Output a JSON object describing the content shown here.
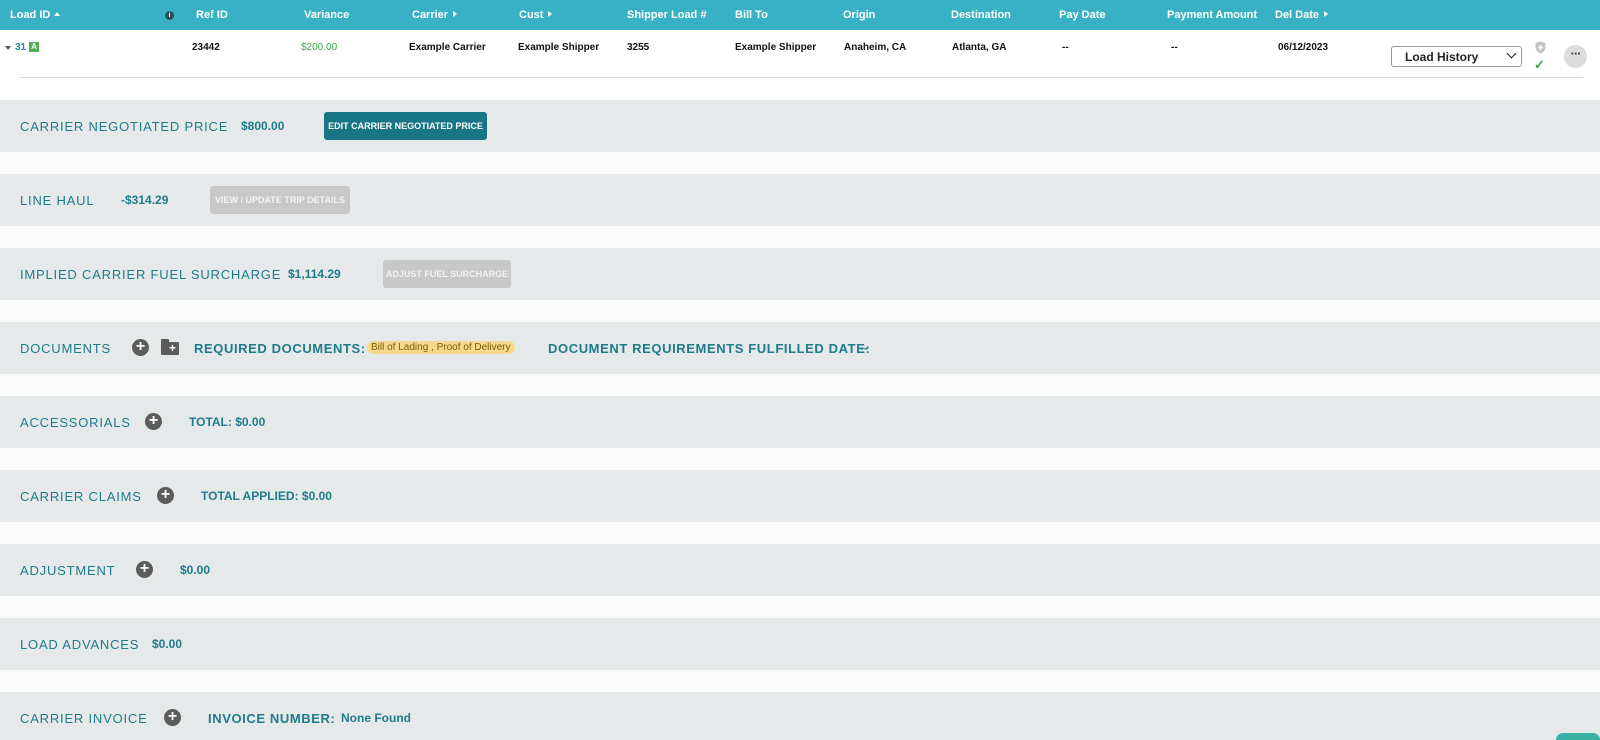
{
  "header": {
    "load_id": "Load ID",
    "ref_id": "Ref ID",
    "variance": "Variance",
    "carrier": "Carrier",
    "cust": "Cust",
    "shipper_load": "Shipper Load #",
    "bill_to": "Bill To",
    "origin": "Origin",
    "destination": "Destination",
    "pay_date": "Pay Date",
    "payment_amount": "Payment Amount",
    "del_date": "Del Date"
  },
  "row": {
    "load_id": "31",
    "badge": "A",
    "ref_id": "23442",
    "variance": "$200.00",
    "carrier": "Example Carrier",
    "cust": "Example Shipper",
    "shipper_load": "3255",
    "bill_to": "Example Shipper",
    "origin": "Anaheim, CA",
    "destination": "Atlanta, GA",
    "pay_date": "--",
    "payment_amount": "--",
    "del_date": "06/12/2023",
    "select_value": "Load History",
    "more": "···"
  },
  "sections": {
    "carrier_price": {
      "label": "CARRIER NEGOTIATED PRICE",
      "value": "$800.00",
      "button": "EDIT CARRIER NEGOTIATED PRICE"
    },
    "line_haul": {
      "label": "LINE HAUL",
      "value": "-$314.29",
      "button": "VIEW / UPDATE TRIP DETAILS"
    },
    "fuel": {
      "label": "IMPLIED CARRIER FUEL SURCHARGE",
      "value": "$1,114.29",
      "button": "ADJUST FUEL SURCHARGE"
    },
    "documents": {
      "label": "DOCUMENTS",
      "required_label": "REQUIRED DOCUMENTS:",
      "required_docs": "Bill of Lading , Proof of Delivery",
      "fulfilled_label": "DOCUMENT REQUIREMENTS FULFILLED DATE:",
      "fulfilled_value": "--"
    },
    "accessorials": {
      "label": "ACCESSORIALS",
      "total": "TOTAL: $0.00"
    },
    "claims": {
      "label": "CARRIER CLAIMS",
      "total": "TOTAL APPLIED: $0.00"
    },
    "adjustment": {
      "label": "ADJUSTMENT",
      "value": "$0.00"
    },
    "advances": {
      "label": "LOAD ADVANCES",
      "value": "$0.00"
    },
    "invoice": {
      "label": "CARRIER INVOICE",
      "number_label": "INVOICE NUMBER:",
      "number_value": "None Found"
    }
  },
  "icons": {
    "plus": "+",
    "folder_plus": "+",
    "info": "i",
    "check": "✓"
  },
  "colors": {
    "header": "#39b1c4",
    "section_bg": "#e6e9e9",
    "section_text": "#1d7b8a",
    "primary_button": "#177585",
    "variance_green": "#3aa84b",
    "doc_pill": "#f7d98e"
  }
}
